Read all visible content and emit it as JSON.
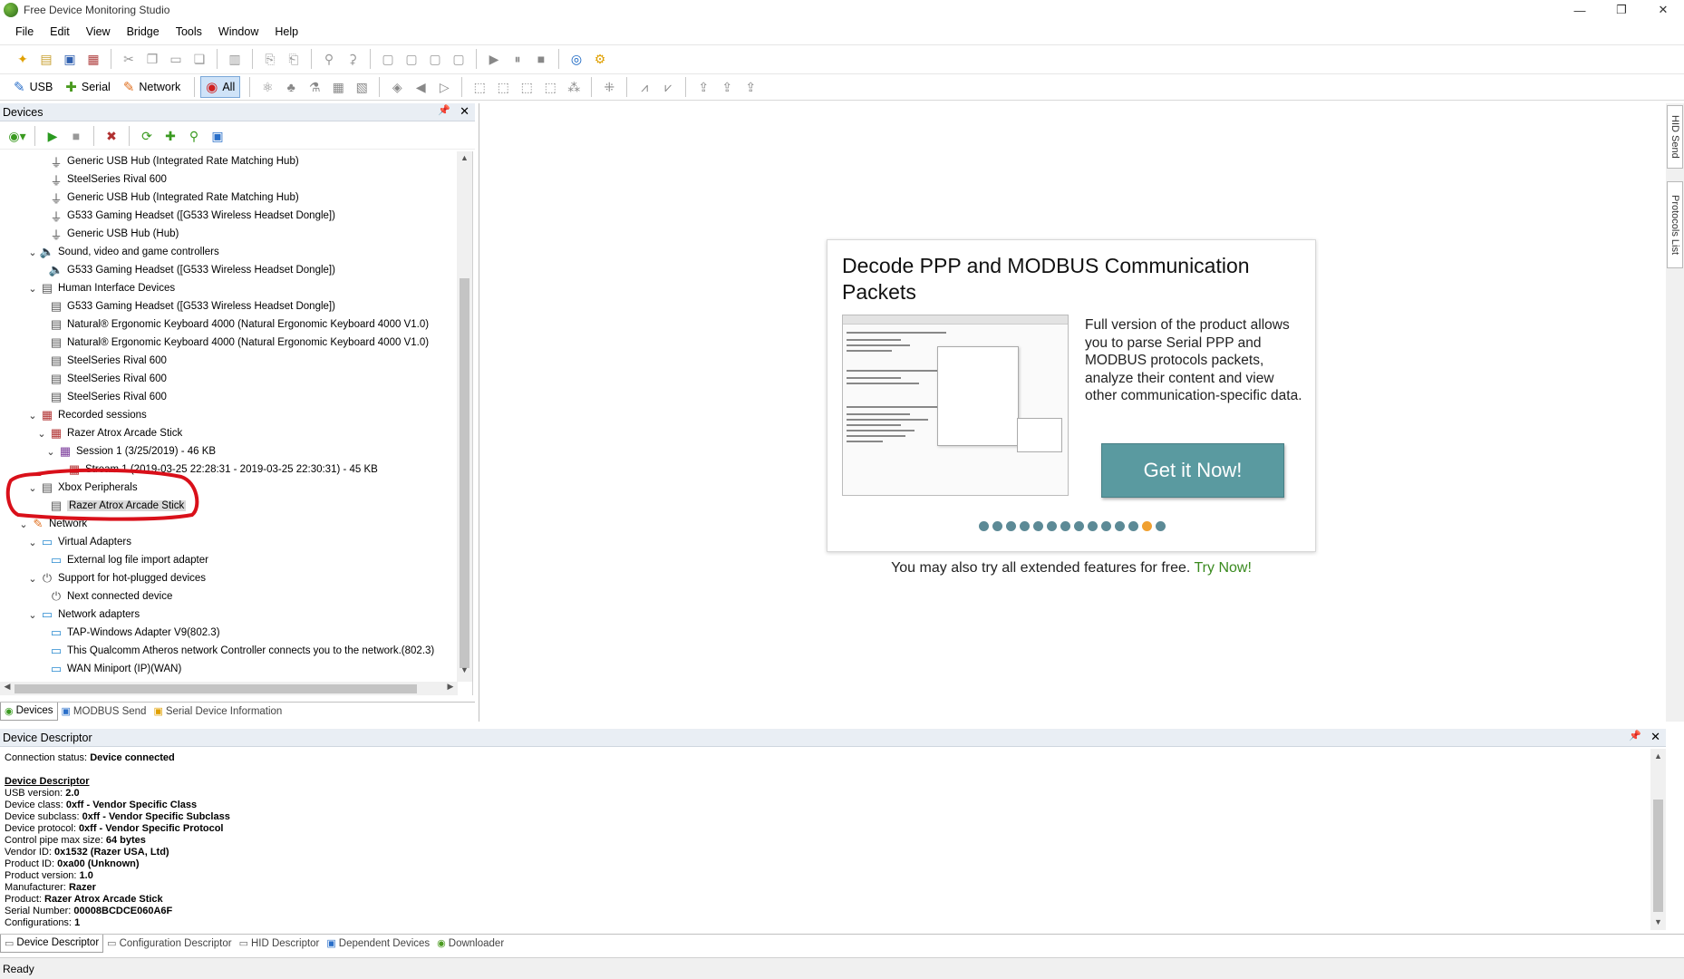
{
  "window": {
    "title": "Free Device Monitoring Studio",
    "controls": {
      "minimize": "—",
      "maximize": "❐",
      "close": "✕"
    }
  },
  "menu": [
    "File",
    "Edit",
    "View",
    "Bridge",
    "Tools",
    "Window",
    "Help"
  ],
  "toolbar2": {
    "usb_label": "USB",
    "serial_label": "Serial",
    "network_label": "Network",
    "all_label": "All"
  },
  "devices_panel": {
    "title": "Devices",
    "pin": "📌",
    "close": "✕",
    "tree": [
      {
        "indent": 2,
        "arrow": "",
        "icon": "usb-plug-icon",
        "label": "Generic USB Hub (Integrated Rate Matching Hub)"
      },
      {
        "indent": 2,
        "arrow": "",
        "icon": "usb-plug-icon",
        "label": "SteelSeries Rival 600"
      },
      {
        "indent": 2,
        "arrow": "",
        "icon": "usb-plug-icon",
        "label": "Generic USB Hub (Integrated Rate Matching Hub)"
      },
      {
        "indent": 2,
        "arrow": "",
        "icon": "usb-plug-icon",
        "label": "G533 Gaming Headset ([G533 Wireless Headset Dongle])"
      },
      {
        "indent": 2,
        "arrow": "",
        "icon": "usb-plug-icon",
        "label": "Generic USB Hub (Hub)"
      },
      {
        "indent": 1,
        "arrow": "v",
        "icon": "speaker-icon",
        "label": "Sound, video and game controllers"
      },
      {
        "indent": 2,
        "arrow": "",
        "icon": "speaker-icon",
        "label": "G533 Gaming Headset ([G533 Wireless Headset Dongle])"
      },
      {
        "indent": 1,
        "arrow": "v",
        "icon": "hid-icon",
        "label": "Human Interface Devices"
      },
      {
        "indent": 2,
        "arrow": "",
        "icon": "hid-icon",
        "label": "G533 Gaming Headset ([G533 Wireless Headset Dongle])"
      },
      {
        "indent": 2,
        "arrow": "",
        "icon": "hid-icon",
        "label": "Natural® Ergonomic Keyboard 4000 (Natural Ergonomic Keyboard 4000 V1.0)"
      },
      {
        "indent": 2,
        "arrow": "",
        "icon": "hid-icon",
        "label": "Natural® Ergonomic Keyboard 4000 (Natural Ergonomic Keyboard 4000 V1.0)"
      },
      {
        "indent": 2,
        "arrow": "",
        "icon": "hid-icon",
        "label": "SteelSeries Rival 600"
      },
      {
        "indent": 2,
        "arrow": "",
        "icon": "hid-icon",
        "label": "SteelSeries Rival 600"
      },
      {
        "indent": 2,
        "arrow": "",
        "icon": "hid-icon",
        "label": "SteelSeries Rival 600"
      },
      {
        "indent": 1,
        "arrow": "v",
        "icon": "recording-icon",
        "label": "Recorded sessions"
      },
      {
        "indent": 2,
        "arrow": "v",
        "icon": "recording-icon",
        "label": "Razer Atrox Arcade Stick"
      },
      {
        "indent": 3,
        "arrow": "v",
        "icon": "session-icon",
        "label": "Session 1 (3/25/2019) - 46 KB"
      },
      {
        "indent": 4,
        "arrow": "",
        "icon": "stream-icon",
        "label": "Stream 1 (2019-03-25 22:28:31 - 2019-03-25 22:30:31) - 45 KB"
      },
      {
        "indent": 1,
        "arrow": "v",
        "icon": "hid-icon",
        "label": "Xbox Peripherals"
      },
      {
        "indent": 2,
        "arrow": "",
        "icon": "hid-icon",
        "label": "Razer Atrox Arcade Stick",
        "selected": true
      },
      {
        "indent": 0,
        "arrow": "v",
        "icon": "network-icon",
        "label": "Network"
      },
      {
        "indent": 1,
        "arrow": "v",
        "icon": "monitor-icon",
        "label": "Virtual Adapters"
      },
      {
        "indent": 2,
        "arrow": "",
        "icon": "monitor-icon",
        "label": "External log file import adapter"
      },
      {
        "indent": 1,
        "arrow": "v",
        "icon": "plug-icon",
        "label": "Support for hot-plugged devices"
      },
      {
        "indent": 2,
        "arrow": "",
        "icon": "plug-icon",
        "label": "Next connected device"
      },
      {
        "indent": 1,
        "arrow": "v",
        "icon": "monitor-icon",
        "label": "Network adapters"
      },
      {
        "indent": 2,
        "arrow": "",
        "icon": "monitor-icon",
        "label": "TAP-Windows Adapter V9(802.3)"
      },
      {
        "indent": 2,
        "arrow": "",
        "icon": "monitor-icon",
        "label": "This Qualcomm Atheros network Controller connects you to the network.(802.3)"
      },
      {
        "indent": 2,
        "arrow": "",
        "icon": "monitor-icon",
        "label": "WAN Miniport (IP)(WAN)"
      }
    ],
    "bottom_tabs": [
      "Devices",
      "MODBUS Send",
      "Serial Device Information"
    ]
  },
  "promo": {
    "title": "Decode PPP and MODBUS Communication Packets",
    "body": "Full version of the product allows you to parse Serial PPP and MODBUS protocols packets, analyze their content and view other communication-specific data.",
    "button": "Get it Now!",
    "dot_count": 14,
    "active_dot": 12,
    "accent": "#5a9aa0",
    "try_text": "You may also try all extended features for free.",
    "try_link": "Try Now!"
  },
  "side_tabs": [
    "HID Send",
    "Protocols List"
  ],
  "descriptor_panel": {
    "title": "Device Descriptor",
    "pin": "📌",
    "close": "✕",
    "status_label": "Connection status:",
    "status_value": "Device connected",
    "heading": "Device Descriptor",
    "fields": [
      {
        "k": "USB version:",
        "v": "2.0"
      },
      {
        "k": "Device class:",
        "v": "0xff - Vendor Specific Class"
      },
      {
        "k": "Device subclass:",
        "v": "0xff - Vendor Specific Subclass"
      },
      {
        "k": "Device protocol:",
        "v": "0xff - Vendor Specific Protocol"
      },
      {
        "k": "Control pipe max size:",
        "v": "64 bytes"
      },
      {
        "k": "Vendor ID:",
        "v": "0x1532 (Razer USA, Ltd)"
      },
      {
        "k": "Product ID:",
        "v": "0xa00 (Unknown)"
      },
      {
        "k": "Product version:",
        "v": "1.0"
      },
      {
        "k": "Manufacturer:",
        "v": "Razer"
      },
      {
        "k": "Product:",
        "v": "Razer Atrox Arcade Stick"
      },
      {
        "k": "Serial Number:",
        "v": "00008BCDCE060A6F"
      },
      {
        "k": "Configurations:",
        "v": "1"
      }
    ],
    "bottom_tabs": [
      "Device Descriptor",
      "Configuration Descriptor",
      "HID Descriptor",
      "Dependent Devices",
      "Downloader"
    ]
  },
  "status_bar": "Ready",
  "colors": {
    "annotation": "#d9101a",
    "link": "#3a8a1f",
    "selection": "#d9d9d9"
  }
}
